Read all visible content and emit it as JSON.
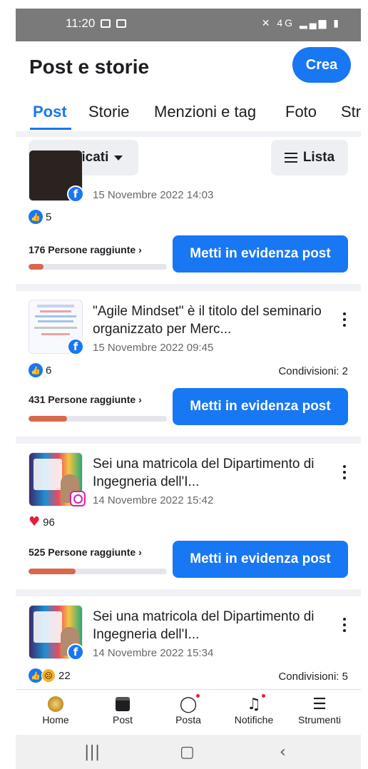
{
  "status_bar": {
    "time": "11:20",
    "icons": "4G"
  },
  "header": {
    "title": "Post e storie",
    "create_label": "Crea"
  },
  "tabs": [
    {
      "label": "Post"
    },
    {
      "label": "Storie"
    },
    {
      "label": "Menzioni e tag"
    },
    {
      "label": "Foto"
    },
    {
      "label": "Str"
    }
  ],
  "filter": {
    "published_label": "Pubblicati",
    "list_label": "Lista"
  },
  "posts": [
    {
      "title": "",
      "date": "15 Novembre 2022 14:03",
      "platform": "facebook",
      "reaction_count": "5",
      "reactions": [
        "like"
      ],
      "shares": "",
      "reach": "176 Persone raggiunte",
      "reach_fraction": 0.11,
      "boost_label": "Metti in evidenza post"
    },
    {
      "title": "\"Agile Mindset\" è il titolo del seminario organizzato per Merc...",
      "date": "15 Novembre 2022 09:45",
      "platform": "facebook",
      "reaction_count": "6",
      "reactions": [
        "like"
      ],
      "shares": "Condivisioni: 2",
      "reach": "431 Persone raggiunte",
      "reach_fraction": 0.28,
      "boost_label": "Metti in evidenza post"
    },
    {
      "title": "Sei una matricola del Dipartimento di Ingegneria dell'I...",
      "date": "14 Novembre 2022 15:42",
      "platform": "instagram",
      "reaction_count": "96",
      "reactions": [
        "love"
      ],
      "shares": "",
      "reach": "525 Persone raggiunte",
      "reach_fraction": 0.34,
      "boost_label": "Metti in evidenza post"
    },
    {
      "title": "Sei una matricola del Dipartimento di Ingegneria dell'I...",
      "date": "14 Novembre 2022 15:34",
      "platform": "facebook",
      "reaction_count": "22",
      "reactions": [
        "like",
        "sad"
      ],
      "shares": "Condivisioni: 5"
    }
  ],
  "bottom_nav": [
    {
      "label": "Home",
      "icon": "home-icon"
    },
    {
      "label": "Post",
      "icon": "post-icon"
    },
    {
      "label": "Posta",
      "icon": "chat-bubble-icon"
    },
    {
      "label": "Notifiche",
      "icon": "bell-icon"
    },
    {
      "label": "Strumenti",
      "icon": "menu-icon"
    }
  ],
  "colors": {
    "accent": "#1877f2",
    "reach_fill": "#d9674d",
    "background": "#ffffff"
  }
}
